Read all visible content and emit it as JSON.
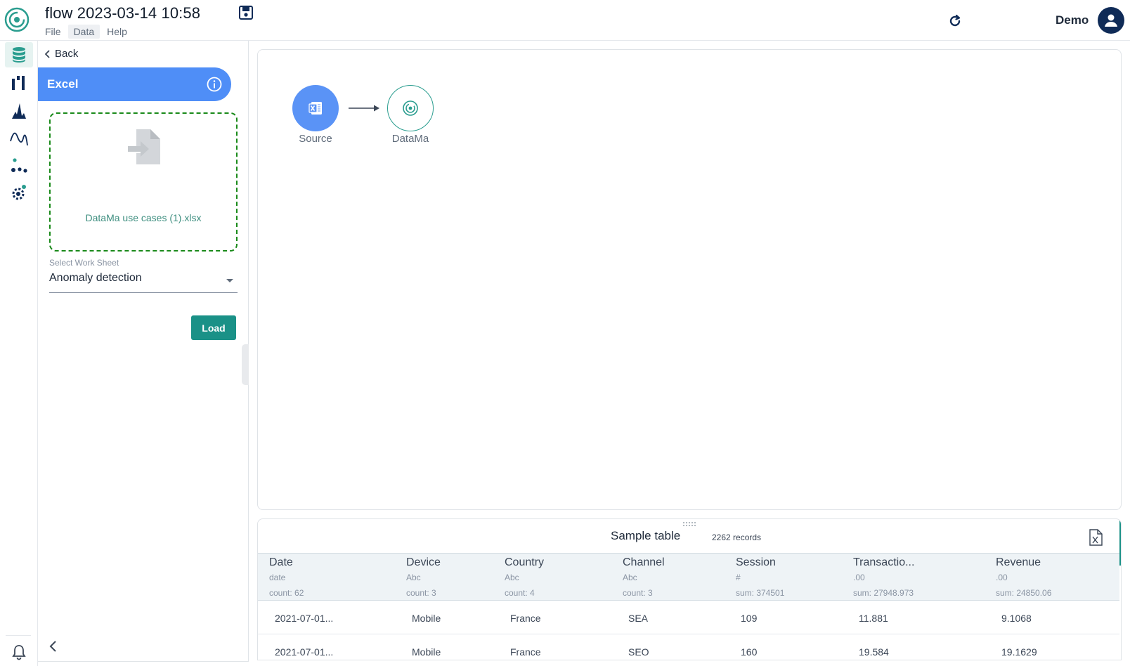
{
  "header": {
    "title": "flow 2023-03-14 10:58",
    "menu": [
      "File",
      "Data",
      "Help"
    ],
    "active_menu": "Data",
    "user": "Demo"
  },
  "rail": {
    "items": [
      "database-icon",
      "columns-icon",
      "histogram-icon",
      "trend-icon",
      "cluster-icon",
      "gear-icon"
    ],
    "active": "database-icon",
    "bottom": "bell-icon"
  },
  "panel": {
    "back_label": "Back",
    "source_title": "Excel",
    "file_name": "DataMa use cases (1).xlsx",
    "sheet_label": "Select Work Sheet",
    "sheet_value": "Anomaly detection",
    "load_label": "Load"
  },
  "flow": {
    "nodes": [
      {
        "label": "Source",
        "icon": "excel-icon"
      },
      {
        "label": "DataMa",
        "icon": "datama-icon"
      }
    ]
  },
  "table": {
    "title": "Sample table",
    "records": "2262 records",
    "columns": [
      {
        "name": "Date",
        "type": "date",
        "stat": "count: 62"
      },
      {
        "name": "Device",
        "type": "Abc",
        "stat": "count: 3"
      },
      {
        "name": "Country",
        "type": "Abc",
        "stat": "count: 4"
      },
      {
        "name": "Channel",
        "type": "Abc",
        "stat": "count: 3"
      },
      {
        "name": "Session",
        "type": "#",
        "stat": "sum: 374501"
      },
      {
        "name": "Transactio...",
        "type": ".00",
        "stat": "sum: 27948.973"
      },
      {
        "name": "Revenue",
        "type": ".00",
        "stat": "sum: 24850.06"
      }
    ],
    "rows": [
      [
        "2021-07-01...",
        "Mobile",
        "France",
        "SEA",
        "109",
        "11.881",
        "9.1068"
      ],
      [
        "2021-07-01...",
        "Mobile",
        "France",
        "SEO",
        "160",
        "19.584",
        "19.1629"
      ]
    ]
  },
  "colors": {
    "accent_blue": "#4f8ef7",
    "accent_teal": "#1a9187",
    "navy": "#0f2b57",
    "dropzone_border": "#1a8a1a"
  }
}
